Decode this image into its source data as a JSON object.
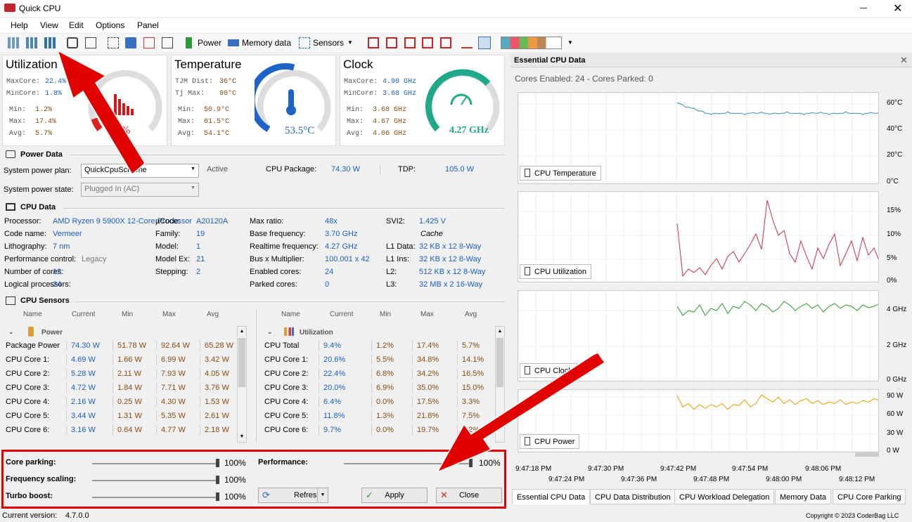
{
  "app": {
    "title": "Quick CPU"
  },
  "menu": [
    "Help",
    "View",
    "Edit",
    "Options",
    "Panel"
  ],
  "toolbar": {
    "power": "Power",
    "memory": "Memory data",
    "sensors": "Sensors"
  },
  "utilization": {
    "title": "Utilization",
    "maxcore_label": "MaxCore:",
    "maxcore": "22.4%",
    "mincore_label": "MinCore:",
    "mincore": "1.8%",
    "min_label": "Min:",
    "min": "1.2%",
    "max_label": "Max:",
    "max": "17.4%",
    "avg_label": "Avg:",
    "avg": "5.7%",
    "gauge": ".4%"
  },
  "temperature": {
    "title": "Temperature",
    "tjm_label": "TJM Dist:",
    "tjm": "36°C",
    "tj_label": "Tj Max:",
    "tj": "90°C",
    "min_label": "Min:",
    "min": "50.9°C",
    "max_label": "Max:",
    "max": "61.5°C",
    "avg_label": "Avg:",
    "avg": "54.1°C",
    "gauge": "53.5°C"
  },
  "clock": {
    "title": "Clock",
    "maxcore_label": "MaxCore:",
    "maxcore": "4.90 GHz",
    "mincore_label": "MinCore:",
    "mincore": "3.68 GHz",
    "min_label": "Min:",
    "min": "3.68 GHz",
    "max_label": "Max:",
    "max": "4.67 GHz",
    "avg_label": "Avg:",
    "avg": "4.06 GHz",
    "gauge": "4.27 GHz"
  },
  "power_data": {
    "title": "Power Data",
    "plan_label": "System power plan:",
    "plan": "QuickCpuScheme",
    "active": "Active",
    "package_label": "CPU Package:",
    "package": "74.30 W",
    "tdp_label": "TDP:",
    "tdp": "105.0 W",
    "state_label": "System power state:",
    "state": "Plugged In (AC)"
  },
  "cpu_data": {
    "title": "CPU Data",
    "col1": [
      {
        "l": "Processor:",
        "v": "AMD Ryzen 9 5900X 12-Core Processor"
      },
      {
        "l": "Code name:",
        "v": "Vermeer"
      },
      {
        "l": "Lithography:",
        "v": "7 nm"
      },
      {
        "l": "Performance control:",
        "v": "Legacy"
      },
      {
        "l": "Number of cores:",
        "v": "12"
      },
      {
        "l": "Logical processors:",
        "v": "24"
      }
    ],
    "col2": [
      {
        "l": "µCode:",
        "v": "A20120A"
      },
      {
        "l": "Family:",
        "v": "19"
      },
      {
        "l": "Model:",
        "v": "1"
      },
      {
        "l": "Model Ex:",
        "v": "21"
      },
      {
        "l": "Stepping:",
        "v": "2"
      }
    ],
    "col3": [
      {
        "l": "Max ratio:",
        "v": "48x"
      },
      {
        "l": "Base frequency:",
        "v": "3.70 GHz"
      },
      {
        "l": "Realtime frequency:",
        "v": "4.27 GHz"
      },
      {
        "l": "Bus x Multiplier:",
        "v": "100.001 x 42"
      },
      {
        "l": "Enabled cores:",
        "v": "24"
      },
      {
        "l": "Parked cores:",
        "v": "0"
      }
    ],
    "col4": [
      {
        "l": "SVI2:",
        "v": "1.425 V"
      },
      {
        "l": "",
        "v": "Cache"
      },
      {
        "l": "L1 Data:",
        "v": "32 KB x 12  8-Way"
      },
      {
        "l": "L1 Ins:",
        "v": "32 KB x 12  8-Way"
      },
      {
        "l": "L2:",
        "v": "512 KB x 12  8-Way"
      },
      {
        "l": "L3:",
        "v": "32 MB x 2  16-Way"
      }
    ]
  },
  "sensors": {
    "title": "CPU Sensors",
    "headers": [
      "Name",
      "Current",
      "Min",
      "Max",
      "Avg"
    ],
    "power_group": "Power",
    "util_group": "Utilization",
    "power_rows": [
      [
        "Package Power",
        "74.30 W",
        "51.78 W",
        "92.64 W",
        "65.28 W"
      ],
      [
        "CPU Core 1:",
        "4.69 W",
        "1.66 W",
        "6.99 W",
        "3.42 W"
      ],
      [
        "CPU Core 2:",
        "5.28 W",
        "2.11 W",
        "7.93 W",
        "4.05 W"
      ],
      [
        "CPU Core 3:",
        "4.72 W",
        "1.84 W",
        "7.71 W",
        "3.76 W"
      ],
      [
        "CPU Core 4:",
        "2.16 W",
        "0.25 W",
        "4.30 W",
        "1.53 W"
      ],
      [
        "CPU Core 5:",
        "3.44 W",
        "1.31 W",
        "5.35 W",
        "2.61 W"
      ],
      [
        "CPU Core 6:",
        "3.16 W",
        "0.64 W",
        "4.77 W",
        "2.18 W"
      ]
    ],
    "util_rows": [
      [
        "CPU Total",
        "9.4%",
        "1.2%",
        "17.4%",
        "5.7%"
      ],
      [
        "CPU Core 1:",
        "20.6%",
        "5.5%",
        "34.8%",
        "14.1%"
      ],
      [
        "CPU Core 2:",
        "22.4%",
        "6.8%",
        "34.2%",
        "16.5%"
      ],
      [
        "CPU Core 3:",
        "20.0%",
        "6.9%",
        "35.0%",
        "15.0%"
      ],
      [
        "CPU Core 4:",
        "6.4%",
        "0.0%",
        "17.5%",
        "3.3%"
      ],
      [
        "CPU Core 5:",
        "11.8%",
        "1.3%",
        "21.8%",
        "7.5%"
      ],
      [
        "CPU Core 6:",
        "9.7%",
        "0.0%",
        "19.7%",
        "5.2%"
      ]
    ]
  },
  "controls": {
    "core_parking": "Core parking:",
    "core_parking_val": "100%",
    "freq": "Frequency scaling:",
    "freq_val": "100%",
    "turbo": "Turbo boost:",
    "turbo_val": "100%",
    "performance": "Performance:",
    "performance_val": "100%",
    "refresh": "Refresh",
    "apply": "Apply",
    "close": "Close"
  },
  "essential": {
    "title": "Essential CPU Data",
    "cores": "Cores Enabled: 24 - Cores Parked: 0",
    "charts": [
      {
        "label": "CPU Temperature",
        "ticks": [
          "60°C",
          "40°C",
          "20°C",
          "0°C"
        ],
        "color": "#3a8fb0"
      },
      {
        "label": "CPU Utilization",
        "ticks": [
          "15%",
          "10%",
          "5%",
          "0%"
        ],
        "color": "#c8304a"
      },
      {
        "label": "CPU Clock",
        "ticks": [
          "4 GHz",
          "2 GHz",
          "0 GHz"
        ],
        "color": "#2a9a2a"
      },
      {
        "label": "CPU Power",
        "ticks": [
          "90 W",
          "60 W",
          "30 W",
          "0 W"
        ],
        "color": "#e0a000"
      }
    ],
    "xticks_top": [
      "9:47:18 PM",
      "9:47:30 PM",
      "9:47:42 PM",
      "9:47:54 PM",
      "9:48:06 PM"
    ],
    "xticks_bottom": [
      "9:47:24 PM",
      "9:47:36 PM",
      "9:47:48 PM",
      "9:48:00 PM",
      "9:48:12 PM"
    ],
    "tabs": [
      "Essential CPU Data",
      "CPU Data Distribution",
      "CPU Workload Delegation",
      "Memory Data",
      "CPU Core Parking"
    ]
  },
  "status": {
    "version_label": "Current version:",
    "version": "4.7.0.0",
    "copyright": "Copyright © 2023 CoderBag LLC"
  }
}
